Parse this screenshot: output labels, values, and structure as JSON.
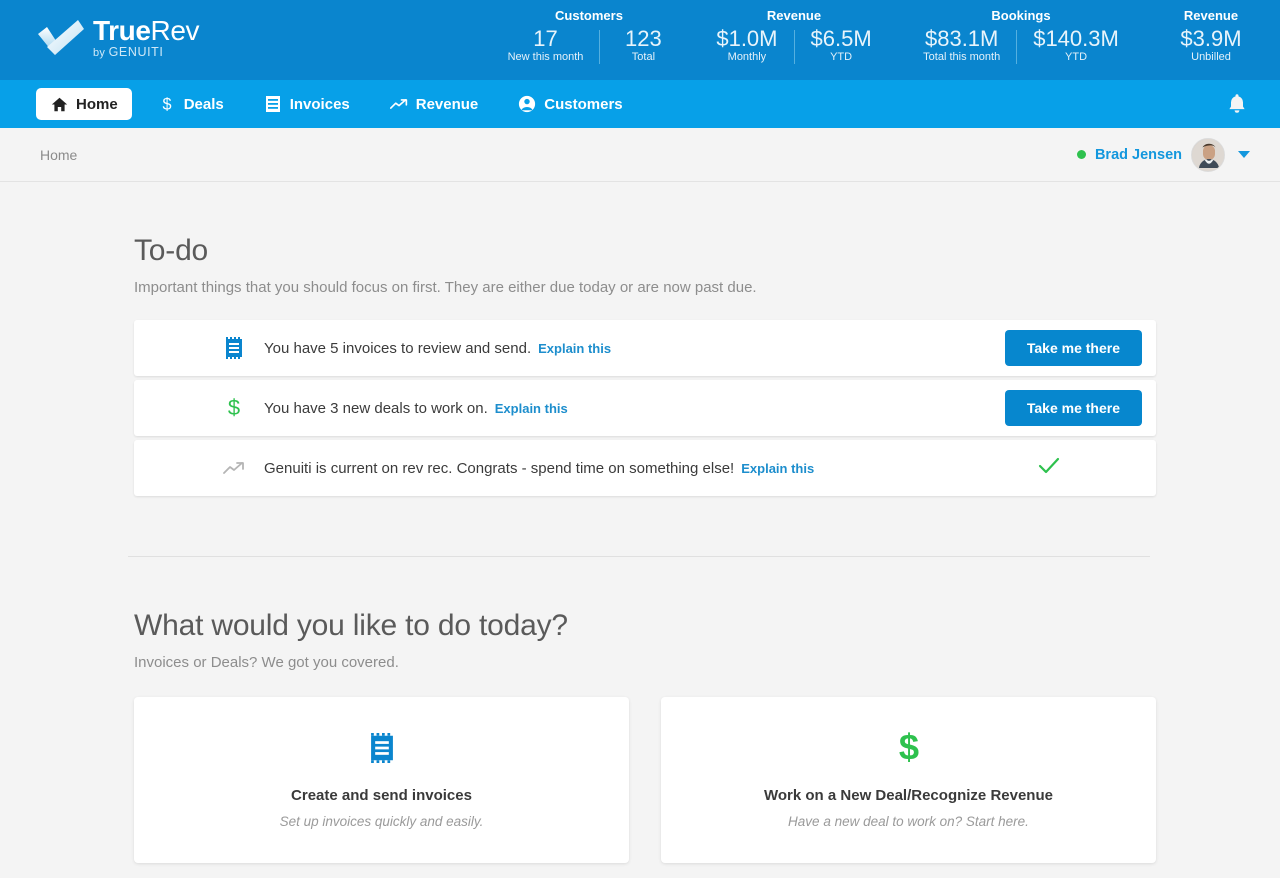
{
  "brand": {
    "name_bold": "True",
    "name_light": "Rev",
    "tagline_prefix": "by ",
    "tagline_company": "Genuiti",
    "logo_icon": "check-mark-logo",
    "primary_color": "#0a85ce",
    "nav_color": "#07a0e8",
    "link_color": "#1d8ecd",
    "success_color": "#2ec14e"
  },
  "header_stats": [
    {
      "title": "Customers",
      "cells": [
        {
          "value": "17",
          "label": "New this month"
        },
        {
          "value": "123",
          "label": "Total"
        }
      ]
    },
    {
      "title": "Revenue",
      "cells": [
        {
          "value": "$1.0M",
          "label": "Monthly"
        },
        {
          "value": "$6.5M",
          "label": "YTD"
        }
      ]
    },
    {
      "title": "Bookings",
      "cells": [
        {
          "value": "$83.1M",
          "label": "Total this month"
        },
        {
          "value": "$140.3M",
          "label": "YTD"
        }
      ]
    },
    {
      "title": "Revenue",
      "cells": [
        {
          "value": "$3.9M",
          "label": "Unbilled"
        }
      ]
    }
  ],
  "nav": {
    "items": [
      {
        "label": "Home",
        "icon": "home-icon",
        "active": true
      },
      {
        "label": "Deals",
        "icon": "dollar-icon",
        "active": false
      },
      {
        "label": "Invoices",
        "icon": "invoice-icon",
        "active": false
      },
      {
        "label": "Revenue",
        "icon": "trend-up-icon",
        "active": false
      },
      {
        "label": "Customers",
        "icon": "person-circle-icon",
        "active": false
      }
    ],
    "notifications_icon": "bell-icon"
  },
  "breadcrumb": {
    "current": "Home"
  },
  "user": {
    "name": "Brad Jensen",
    "status": "online",
    "avatar_alt": "user-avatar",
    "menu_icon": "chevron-down-icon"
  },
  "todo": {
    "title": "To-do",
    "subtitle": "Important things that you should focus on first. They are either due today or are now past due.",
    "items": [
      {
        "icon": "invoice-icon",
        "icon_color": "#0a85ce",
        "text": "You have 5 invoices to review and send.",
        "explain_label": "Explain this",
        "action_label": "Take me there",
        "action_type": "button"
      },
      {
        "icon": "dollar-icon",
        "icon_color": "#2ec14e",
        "text": "You have 3 new deals to work on.",
        "explain_label": "Explain this",
        "action_label": "Take me there",
        "action_type": "button"
      },
      {
        "icon": "trend-up-icon",
        "icon_color": "#b5b5b5",
        "text": "Genuiti is current on rev rec. Congrats - spend time on something else!",
        "explain_label": "Explain this",
        "action_label": "",
        "action_type": "check"
      }
    ]
  },
  "quick_actions": {
    "title": "What would you like to do today?",
    "subtitle": "Invoices or Deals? We got you covered.",
    "cards": [
      {
        "icon": "invoice-icon",
        "icon_color": "#0a85ce",
        "title": "Create and send invoices",
        "desc": "Set up invoices quickly and easily."
      },
      {
        "icon": "dollar-icon",
        "icon_color": "#2ec14e",
        "title": "Work on a New Deal/Recognize Revenue",
        "desc": "Have a new deal to work on? Start here."
      }
    ]
  }
}
